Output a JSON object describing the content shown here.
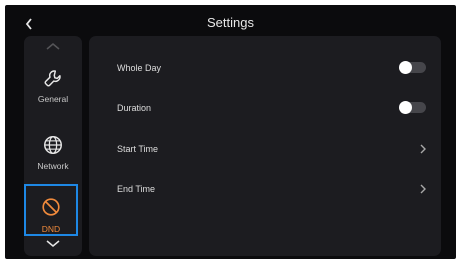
{
  "header": {
    "title": "Settings",
    "back_icon": "chevron-left-icon"
  },
  "sidebar": {
    "scroll_up_icon": "chevron-up-icon",
    "scroll_down_icon": "chevron-down-icon",
    "items": [
      {
        "label": "General",
        "icon": "wrench-icon",
        "selected": false
      },
      {
        "label": "Network",
        "icon": "globe-icon",
        "selected": false
      },
      {
        "label": "DND",
        "icon": "prohibited-icon",
        "selected": true
      }
    ]
  },
  "main": {
    "rows": [
      {
        "label": "Whole Day",
        "control": "toggle",
        "value": "off"
      },
      {
        "label": "Duration",
        "control": "toggle",
        "value": "off"
      },
      {
        "label": "Start Time",
        "control": "chevron"
      },
      {
        "label": "End Time",
        "control": "chevron"
      }
    ]
  },
  "colors": {
    "background": "#0b0b0d",
    "panel": "#1c1c20",
    "selected_label": "#f08a3c",
    "selection_border": "#1e88e5",
    "toggle_track": "#46464b"
  }
}
